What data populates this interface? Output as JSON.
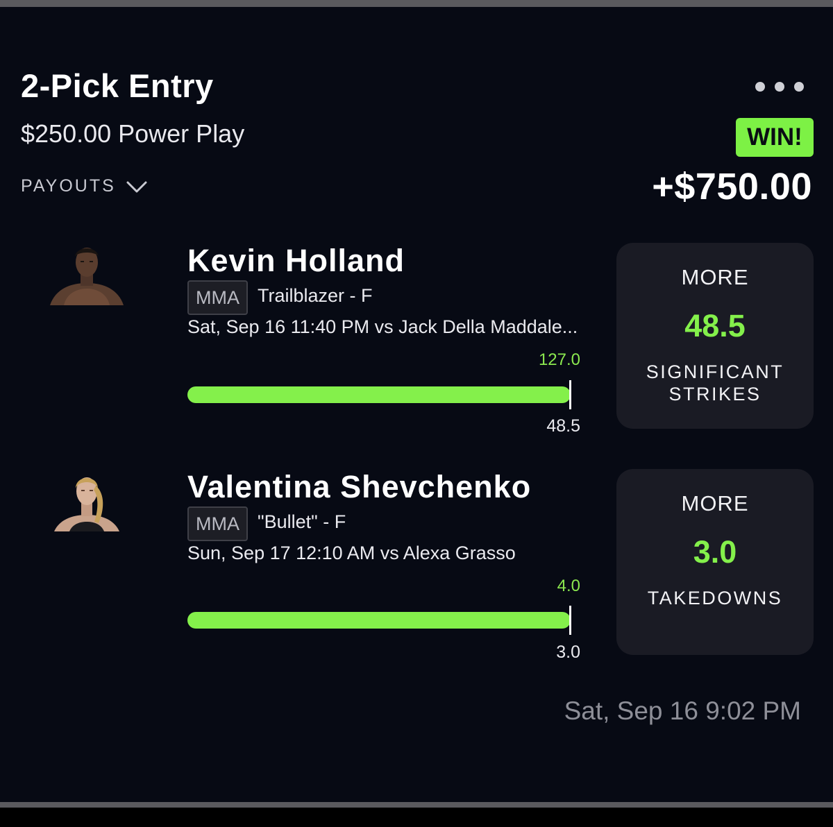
{
  "entry": {
    "title": "2-Pick Entry",
    "subtitle": "$250.00 Power Play",
    "payouts_label": "PAYOUTS",
    "result_badge": "WIN!",
    "result_amount": "+$750.00",
    "timestamp": "Sat, Sep 16 9:02 PM"
  },
  "picks": [
    {
      "player": "Kevin Holland",
      "league": "MMA",
      "team": "Trailblazer - F",
      "game": "Sat, Sep 16 11:40 PM  vs Jack Della Maddale...",
      "actual": "127.0",
      "line": "48.5",
      "progress": 1.0,
      "direction": "MORE",
      "projection": "48.5",
      "stat": "SIGNIFICANT STRIKES"
    },
    {
      "player": "Valentina Shevchenko",
      "league": "MMA",
      "team": "\"Bullet\" - F",
      "game": "Sun, Sep 17 12:10 AM  vs Alexa Grasso",
      "actual": "4.0",
      "line": "3.0",
      "progress": 1.0,
      "direction": "MORE",
      "projection": "3.0",
      "stat": "TAKEDOWNS"
    }
  ],
  "colors": {
    "accent_green": "#84f04b",
    "badge_green": "#7df145",
    "card_bg": "#070a14",
    "panel_bg": "#1a1b24"
  },
  "icons": {
    "menu": "more-dots-icon",
    "payouts_toggle": "chevron-down-icon"
  }
}
